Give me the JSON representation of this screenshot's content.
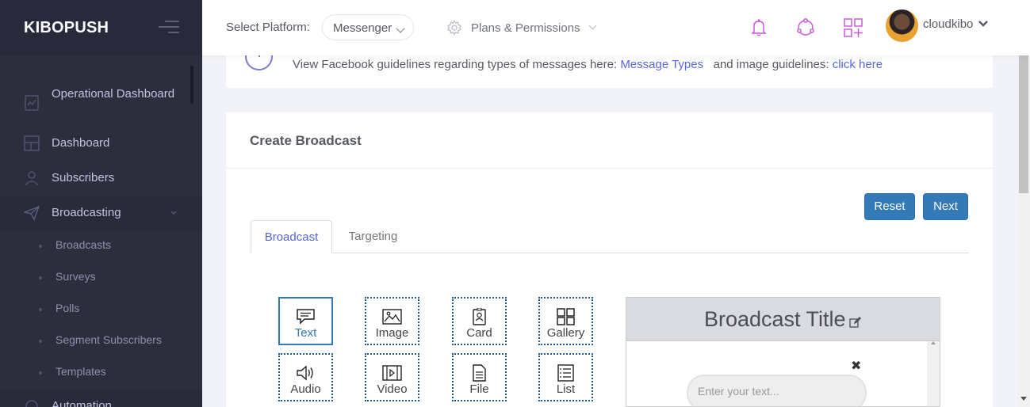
{
  "brand": {
    "name": "KIBOPUSH"
  },
  "sidebar": {
    "items": [
      {
        "label": "Operational Dashboard",
        "icon": "operational-dashboard-icon"
      },
      {
        "label": "Dashboard",
        "icon": "dashboard-icon"
      },
      {
        "label": "Subscribers",
        "icon": "subscribers-icon"
      },
      {
        "label": "Broadcasting",
        "icon": "paper-plane-icon"
      }
    ],
    "sub_items": [
      "Broadcasts",
      "Surveys",
      "Polls",
      "Segment Subscribers",
      "Templates"
    ],
    "next_item": {
      "label": "Automation"
    }
  },
  "header": {
    "platform_label": "Select Platform:",
    "platform_value": "Messenger",
    "plans_label": "Plans & Permissions",
    "user_name": "cloudkibo",
    "accent": "#c94fd6"
  },
  "guidelines": {
    "text_before": "View Facebook guidelines regarding types of messages here:",
    "link1": "Message Types",
    "text_middle": "and image guidelines:",
    "link2": "click here"
  },
  "create": {
    "title": "Create Broadcast",
    "reset_label": "Reset",
    "next_label": "Next",
    "tabs": [
      "Broadcast",
      "Targeting"
    ],
    "components": [
      "Text",
      "Image",
      "Card",
      "Gallery",
      "Audio",
      "Video",
      "File",
      "List"
    ],
    "preview_title": "Broadcast Title",
    "input_placeholder": "Enter your text...",
    "close_glyph": "✖"
  }
}
